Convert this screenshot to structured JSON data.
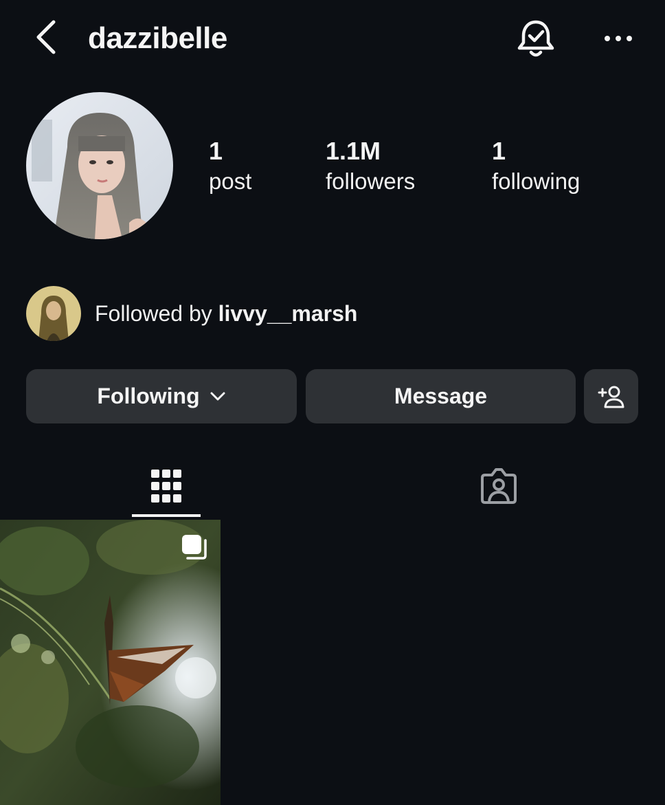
{
  "header": {
    "username": "dazzibelle"
  },
  "stats": {
    "posts": {
      "value": "1",
      "label": "post"
    },
    "followers": {
      "value": "1.1M",
      "label": "followers"
    },
    "following": {
      "value": "1",
      "label": "following"
    }
  },
  "mutual": {
    "prefix": "Followed by",
    "name": "livvy__marsh"
  },
  "actions": {
    "following_label": "Following",
    "message_label": "Message"
  },
  "icons": {
    "back": "chevron-left-icon",
    "notifications": "bell-check-icon",
    "more": "more-horizontal-icon",
    "add_person": "add-person-icon",
    "grid_tab": "grid-icon",
    "tagged_tab": "tagged-person-icon",
    "multi_post": "carousel-icon"
  },
  "colors": {
    "background": "#0c0f14",
    "button": "#2e3135",
    "text": "#f5f5f5"
  }
}
